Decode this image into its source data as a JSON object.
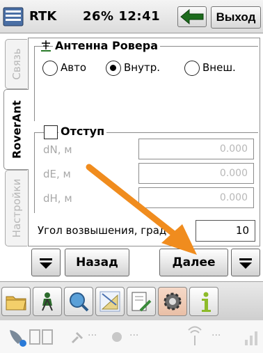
{
  "titlebar": {
    "mode": "RTK",
    "status": "26% 12:41",
    "exit_label": "Выход"
  },
  "tabs": [
    {
      "label": "Связь",
      "active": false
    },
    {
      "label": "RoverAnt",
      "active": true
    },
    {
      "label": "Настройки",
      "active": false
    }
  ],
  "antenna_group": {
    "title": "Антенна Ровера",
    "options": [
      {
        "label": "Авто",
        "selected": false
      },
      {
        "label": "Внутр.",
        "selected": true
      },
      {
        "label": "Внеш.",
        "selected": false
      }
    ]
  },
  "offset_group": {
    "title": "Отступ",
    "checked": false,
    "fields": [
      {
        "label": "dN, м",
        "value": "0.000"
      },
      {
        "label": "dE, м",
        "value": "0.000"
      },
      {
        "label": "dH, м",
        "value": "0.000"
      }
    ]
  },
  "elevation": {
    "label": "Угол возвышения, град",
    "value": "10"
  },
  "nav": {
    "back_label": "Назад",
    "next_label": "Далее"
  },
  "apps": [
    "folder-icon",
    "surveyor-icon",
    "search-globe-icon",
    "drawing-tools-icon",
    "notebook-pen-icon",
    "gear-icon",
    "info-icon"
  ],
  "tray": {
    "items": [
      "satellite-icon",
      "battery-icon",
      "connection-icon",
      "bluetooth-icon",
      "antenna-icon",
      "signal-bars-icon"
    ],
    "placeholder": "..."
  },
  "colors": {
    "accent_arrow": "#f08c1e",
    "back_arrow": "#1c6b1c"
  }
}
